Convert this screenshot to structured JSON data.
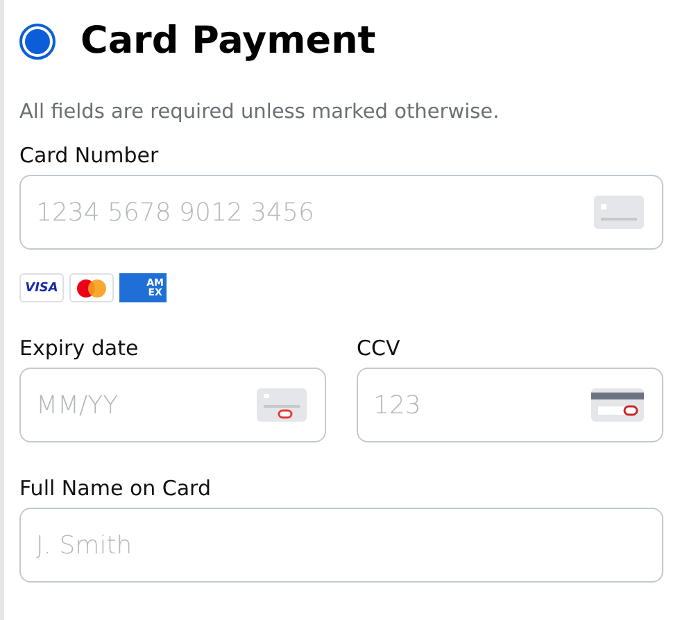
{
  "payment_option": {
    "title": "Card Payment",
    "selected": true
  },
  "note": "All fields are required unless marked otherwise.",
  "card_number": {
    "label": "Card Number",
    "placeholder": "1234 5678 9012 3456"
  },
  "card_brands": [
    {
      "kind": "visa",
      "text": "VISA"
    },
    {
      "kind": "mastercard"
    },
    {
      "kind": "amex",
      "text": "AM EX"
    }
  ],
  "expiry": {
    "label": "Expiry date",
    "placeholder": "MM/YY"
  },
  "ccv": {
    "label": "CCV",
    "placeholder": "123"
  },
  "full_name": {
    "label": "Full Name on Card",
    "placeholder": "J. Smith"
  }
}
